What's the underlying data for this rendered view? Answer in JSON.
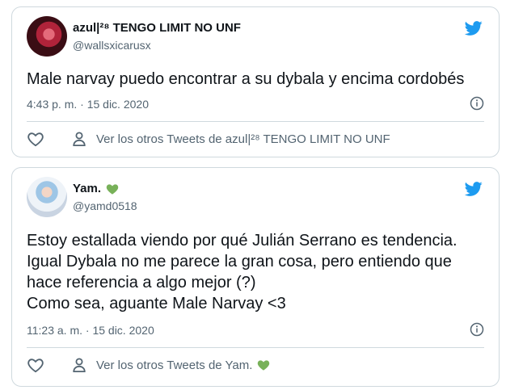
{
  "tweets": [
    {
      "display_name": "azul|²⁸ TENGO LIMIT NO UNF",
      "handle": "@wallsxicarusx",
      "text_lines": [
        "Male narvay puedo encontrar a su dybala y encima cordobés"
      ],
      "timestamp": "4:43 p. m. · 15 dic. 2020",
      "more_tweets_label": "Ver los otros Tweets de azul|²⁸ TENGO LIMIT NO UNF",
      "has_heart_badge": false
    },
    {
      "display_name": "Yam.",
      "handle": "@yamd0518",
      "text_lines": [
        "Estoy estallada viendo por qué Julián Serrano es tendencia.",
        "Igual Dybala no me parece la gran cosa, pero entiendo que",
        "hace referencia a algo mejor (?)",
        "Como sea, aguante Male Narvay <3"
      ],
      "timestamp": "11:23 a. m. · 15 dic. 2020",
      "more_tweets_label": "Ver los otros Tweets de Yam.",
      "has_heart_badge": true
    }
  ],
  "colors": {
    "twitter_blue": "#1d9bf0",
    "green_heart": "#78b159",
    "muted_text": "#536471",
    "border": "#cfd9de"
  },
  "icons": {
    "brand": "twitter-bird-icon",
    "info": "info-icon",
    "like": "heart-outline-icon",
    "profile": "person-icon",
    "badge": "green-heart-icon"
  }
}
